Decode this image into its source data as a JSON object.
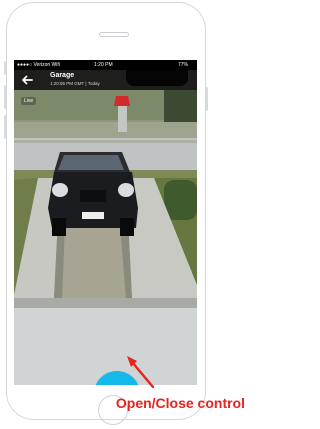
{
  "status_bar": {
    "carrier": "●●●●○ Verizon Wifi",
    "time": "1:20 PM",
    "battery": "77%"
  },
  "app_bar": {
    "back_icon": "back-arrow-icon",
    "title": "Garage",
    "subtitle": "1:20:55 PM GMT | Today"
  },
  "video": {
    "live_label": "Live"
  },
  "control": {
    "icon": "garage-door-icon",
    "color": "#14b9ea"
  },
  "annotation": {
    "caption": "Open/Close control",
    "color": "#e5231f"
  }
}
